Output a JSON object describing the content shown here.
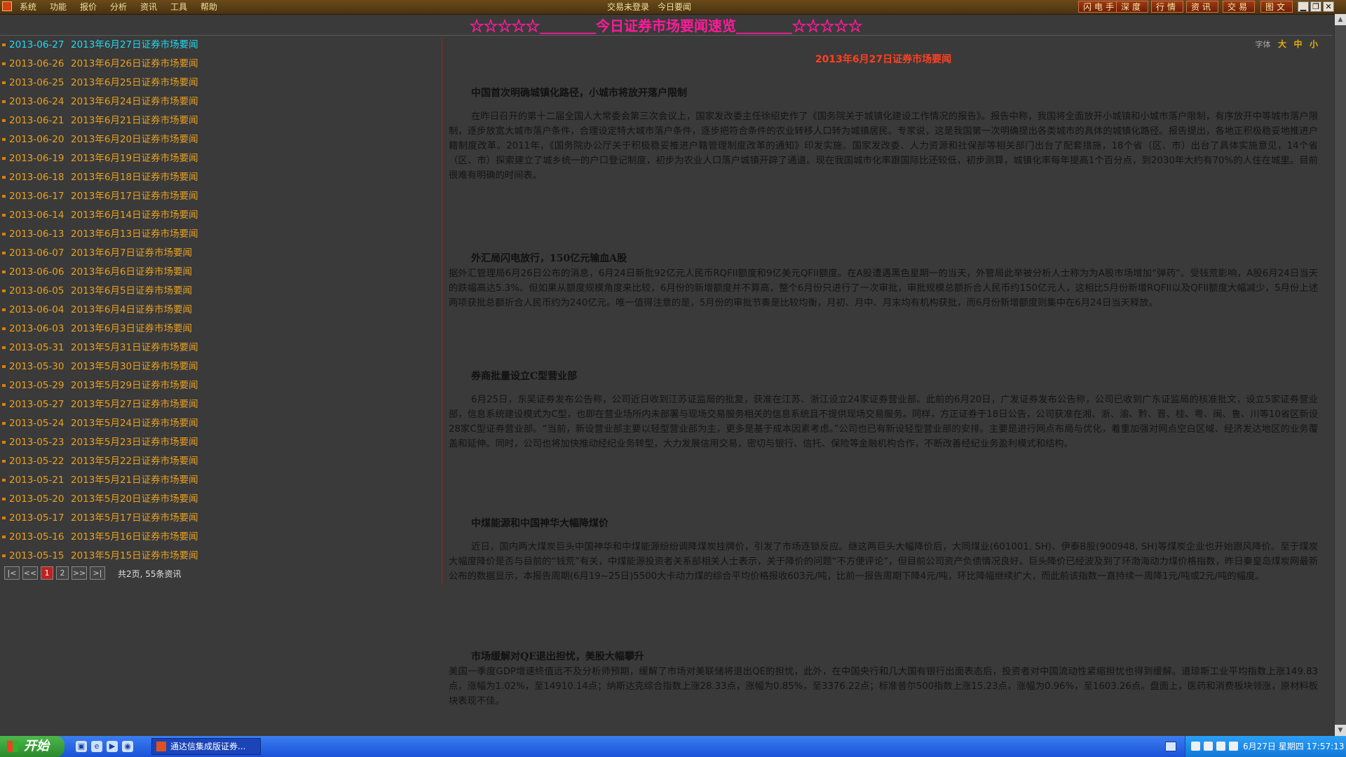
{
  "menubar": {
    "items": [
      "系统",
      "功能",
      "报价",
      "分析",
      "资讯",
      "工具",
      "帮助"
    ],
    "login_status": "交易未登录",
    "news_label": "今日要闻",
    "tool_buttons": [
      "闪电手",
      "深度",
      "行情",
      "资讯",
      "交易",
      "图文"
    ],
    "window_buttons": [
      "minimize-icon",
      "restore-icon",
      "close-icon"
    ]
  },
  "banner": {
    "title": "☆☆☆☆☆________今日证券市场要闻速览________☆☆☆☆☆"
  },
  "news_list": [
    {
      "date": "2013-06-27",
      "title": "2013年6月27日证券市场要闻"
    },
    {
      "date": "2013-06-26",
      "title": "2013年6月26日证券市场要闻"
    },
    {
      "date": "2013-06-25",
      "title": "2013年6月25日证券市场要闻"
    },
    {
      "date": "2013-06-24",
      "title": "2013年6月24日证券市场要闻"
    },
    {
      "date": "2013-06-21",
      "title": "2013年6月21日证券市场要闻"
    },
    {
      "date": "2013-06-20",
      "title": "2013年6月20日证券市场要闻"
    },
    {
      "date": "2013-06-19",
      "title": "2013年6月19日证券市场要闻"
    },
    {
      "date": "2013-06-18",
      "title": "2013年6月18日证券市场要闻"
    },
    {
      "date": "2013-06-17",
      "title": "2013年6月17日证券市场要闻"
    },
    {
      "date": "2013-06-14",
      "title": "2013年6月14日证券市场要闻"
    },
    {
      "date": "2013-06-13",
      "title": "2013年6月13日证券市场要闻"
    },
    {
      "date": "2013-06-07",
      "title": "2013年6月7日证券市场要闻"
    },
    {
      "date": "2013-06-06",
      "title": "2013年6月6日证券市场要闻"
    },
    {
      "date": "2013-06-05",
      "title": "2013年6月5日证券市场要闻"
    },
    {
      "date": "2013-06-04",
      "title": "2013年6月4日证券市场要闻"
    },
    {
      "date": "2013-06-03",
      "title": "2013年6月3日证券市场要闻"
    },
    {
      "date": "2013-05-31",
      "title": "2013年5月31日证券市场要闻"
    },
    {
      "date": "2013-05-30",
      "title": "2013年5月30日证券市场要闻"
    },
    {
      "date": "2013-05-29",
      "title": "2013年5月29日证券市场要闻"
    },
    {
      "date": "2013-05-27",
      "title": "2013年5月27日证券市场要闻"
    },
    {
      "date": "2013-05-24",
      "title": "2013年5月24日证券市场要闻"
    },
    {
      "date": "2013-05-23",
      "title": "2013年5月23日证券市场要闻"
    },
    {
      "date": "2013-05-22",
      "title": "2013年5月22日证券市场要闻"
    },
    {
      "date": "2013-05-21",
      "title": "2013年5月21日证券市场要闻"
    },
    {
      "date": "2013-05-20",
      "title": "2013年5月20日证券市场要闻"
    },
    {
      "date": "2013-05-17",
      "title": "2013年5月17日证券市场要闻"
    },
    {
      "date": "2013-05-16",
      "title": "2013年5月16日证券市场要闻"
    },
    {
      "date": "2013-05-15",
      "title": "2013年5月15日证券市场要闻"
    }
  ],
  "pager": {
    "first": "|<",
    "prev": "<<",
    "page1": "1",
    "page2": "2",
    "next": ">>",
    "last": ">|",
    "info": "共2页, 55条资讯"
  },
  "article": {
    "font_label": "字体",
    "font_sizes": [
      "大",
      "中",
      "小"
    ],
    "title": "2013年6月27日证券市场要闻",
    "sections": [
      {
        "heading": "中国首次明确城镇化路径，小城市将放开落户限制",
        "body": "在昨日召开的第十二届全国人大常委会第三次会议上，国家发改委主任徐绍史作了《国务院关于城镇化建设工作情况的报告》。报告中称，我国将全面放开小城镇和小城市落户限制，有序放开中等城市落户限制，逐步放宽大城市落户条件，合理设定特大城市落户条件，逐步把符合条件的农业转移人口转为城镇居民。专家说，这是我国第一次明确提出各类城市的具体的城镇化路径。报告提出，各地正积极稳妥地推进户籍制度改革。2011年，《国务院办公厅关于积极稳妥推进户籍管理制度改革的通知》印发实施。国家发改委、人力资源和社保部等相关部门出台了配套措施，18个省（区、市）出台了具体实施意见，14个省（区、市）探索建立了城乡统一的户口登记制度，初步为农业人口落户城镇开辟了通道。现在我国城市化率跟国际比还较低，初步测算，城镇化率每年提高1个百分点，到2030年大约有70%的人住在城里。目前很难有明确的时间表。"
      },
      {
        "heading": "外汇局闪电放行，150亿元输血A股",
        "body": "据外汇管理局6月26日公布的消息，6月24日新批92亿元人民币RQFII额度和9亿美元QFII额度。在A股遭遇黑色星期一的当天，外管局此举被分析人士称为为A股市场增加“弹药”。受钱荒影响，A股6月24日当天的跌幅高达5.3%。但如果从额度规模角度来比较，6月份的新增额度并不算高，整个6月份只进行了一次审批，审批规模总额折合人民币约150亿元人，这相比5月份新增RQFII以及QFII额度大幅减少，5月份上述两项获批总额折合人民币约为240亿元。唯一值得注意的是，5月份的审批节奏是比较均衡，月初、月中、月末均有机构获批，而6月份新增额度则集中在6月24日当天释放。"
      },
      {
        "heading": "券商批量设立C型营业部",
        "body": "6月25日，东吴证券发布公告称，公司近日收到江苏证监局的批复，获准在江苏、浙江设立24家证券营业部。此前的6月20日，广发证券发布公告称，公司已收到广东证监局的核准批文，设立5家证券营业部，信息系统建设模式为C型，也即在营业场所内未部署与现场交易服务相关的信息系统且不提供现场交易服务。同样，方正证券于18日公告，公司获准在湘、浙、渝、黔、晋、桂、粤、闽、鲁、川等10省区新设28家C型证券营业部。“当前，新设营业部主要以轻型营业部为主，更多是基于成本因素考虑。”公司也已有新设轻型营业部的安排。主要是进行网点布局与优化，着重加强对网点空白区域、经济发达地区的业务覆盖和延伸。同时，公司也将加快推动经纪业务转型，大力发展信用交易，密切与银行、信托、保险等金融机构合作，不断改善经纪业务盈利模式和结构。"
      },
      {
        "heading": "中煤能源和中国神华大幅降煤价",
        "body": "近日，国内两大煤炭巨头中国神华和中煤能源纷纷调降煤炭挂牌价，引发了市场连锁反应。继这两巨头大幅降价后，大同煤业(601001, SH)、伊泰B股(900948, SH)等煤炭企业也开始跟风降价。至于煤炭大幅度降价是否与目前的“钱荒”有关，中煤能源投资者关系部相关人士表示，关于降价的问题“不方便评论”，但目前公司资产负债情况良好。巨头降价已经波及到了环渤海动力煤价格指数，昨日秦皇岛煤炭网最新公布的数据显示，本报告周期(6月19~25日)5500大卡动力煤的综合平均价格报收603元/吨，比前一报告周期下降4元/吨，环比降幅继续扩大，而此前该指数一直持续一周降1元/吨或2元/吨的幅度。"
      },
      {
        "heading": "市场缓解对QE退出担忧，美股大幅攀升",
        "body": "美国一季度GDP增速终值远不及分析师预期，缓解了市场对美联储将退出QE的担忧，此外，在中国央行和几大国有银行出面表态后，投资者对中国流动性紧缩担忧也得到缓解。道琼斯工业平均指数上涨149.83点，涨幅为1.02%，至14910.14点；纳斯达克综合指数上涨28.33点，涨幅为0.85%，至3376.22点；标准普尔500指数上涨15.23点，涨幅为0.96%，至1603.26点。盘面上，医药和消费板块领涨，原材料板块表现不佳。"
      }
    ]
  },
  "taskbar": {
    "start_label": "开始",
    "task_label": "通达信集成版证券...",
    "clock": "6月27日 星期四 17:57:13"
  },
  "colors": {
    "active_item": "#22d8f0",
    "list_item": "#e8a020",
    "banner": "#ff1a9a",
    "article_title": "#ff4020"
  }
}
